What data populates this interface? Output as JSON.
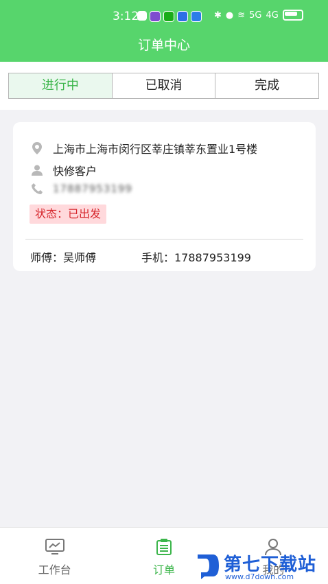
{
  "status_bar": {
    "time": "3:12",
    "signal_5g": "5G",
    "signal_4g": "4G"
  },
  "header": {
    "title": "订单中心"
  },
  "tabs": [
    {
      "label": "进行中",
      "active": true
    },
    {
      "label": "已取消",
      "active": false
    },
    {
      "label": "完成",
      "active": false
    }
  ],
  "order": {
    "address": "上海市上海市闵行区莘庄镇莘东置业1号楼",
    "customer": "快修客户",
    "phone_blurred": "17887953199",
    "status": "状态：已出发",
    "master": "师傅：吴师傅",
    "mobile": "手机：17887953199"
  },
  "bottom_nav": [
    {
      "label": "工作台",
      "icon": "monitor-icon",
      "active": false
    },
    {
      "label": "订单",
      "icon": "clipboard-icon",
      "active": true
    },
    {
      "label": "我的",
      "icon": "user-icon",
      "active": false
    }
  ],
  "watermark": {
    "title": "第七下载站",
    "url": "www.d7down.com"
  },
  "colors": {
    "primary": "#57d56c",
    "active_text": "#3bb54a",
    "status_bg": "#ffd9dc",
    "status_text": "#d6252b",
    "watermark": "#1f5fd6"
  }
}
